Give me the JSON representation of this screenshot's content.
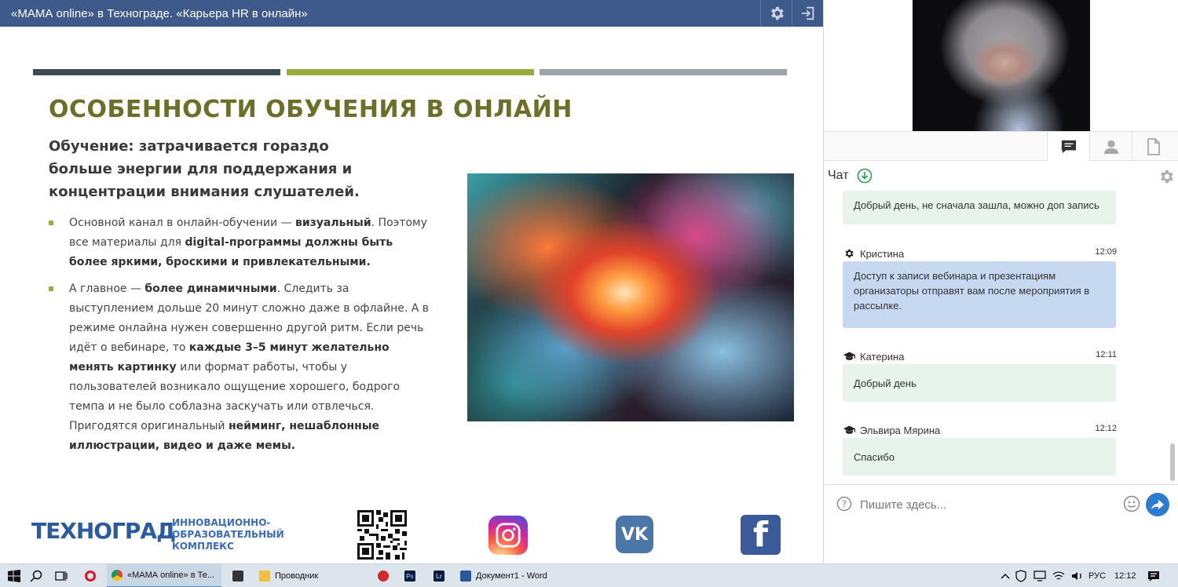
{
  "window": {
    "title": "«МАМА online» в Технограде. «Карьера HR в онлайн»"
  },
  "slide": {
    "heading": "ОСОБЕННОСТИ ОБУЧЕНИЯ В ОНЛАЙН",
    "subheading": "Обучение: затрачивается гораздо больше энергии для поддержания и концентрации внимания слушателей.",
    "bullet1": {
      "p1": "Основной канал в онлайн-обучении — ",
      "b1": "визуальный",
      "p2": ". Поэтому все материалы для ",
      "b2": "digital-программы должны быть более яркими, броскими и привлекательными."
    },
    "bullet2": {
      "p1": "А главное — ",
      "b1": "более динамичными",
      "p2": ". Следить за выступлением дольше 20 минут сложно даже в офлайне. А в режиме онлайна нужен совершенно другой ритм. Если речь идёт о вебинаре, то ",
      "b2": "каждые 3–5 минут желательно менять картинку",
      "p3": " или формат работы, чтобы у пользователей возникало ощущение хорошего, бодрого темпа и не было соблазна заскучать или отвлечься. Пригодятся оригинальный ",
      "b3": "нейминг, нешаблонные иллюстрации, видео и даже мемы."
    },
    "footer": {
      "logo": "ТЕХНОГРАД",
      "logo_sub": "ИННОВАЦИОННО-ОБРАЗОВАТЕЛЬНЫЙ КОМПЛЕКС",
      "vk": "VK",
      "fb": "f"
    }
  },
  "chat": {
    "title": "Чат",
    "messages": [
      {
        "author": "",
        "time": "",
        "text": "Добрый день, не сначала зашла, можно доп запись",
        "style": "green"
      },
      {
        "author": "Кристина",
        "time": "12:09",
        "text": "Доступ к записи вебинара и презентациям организаторы отправят вам после мероприятия в рассылке.",
        "style": "blue",
        "icon": "gear-icon"
      },
      {
        "author": "Катерина",
        "time": "12:11",
        "text": "Добрый день",
        "style": "green",
        "icon": "graduation-cap-icon"
      },
      {
        "author": "Эльвира Мярина",
        "time": "12:12",
        "text": "Спасибо",
        "style": "green",
        "icon": "graduation-cap-icon"
      }
    ],
    "input_placeholder": "Пишите здесь..."
  },
  "taskbar": {
    "chrome_label": "«МАМА online» в Те...",
    "explorer_label": "Проводник",
    "word_label": "Документ1 - Word",
    "ps_label": "Ps",
    "lr_label": "Lr",
    "lang": "РУС",
    "clock": "12:12"
  },
  "colors": {
    "titlebar": "#3e5a8a",
    "heading": "#6b6f28",
    "accent_green": "#9aab3c",
    "bubble_green": "#e6f4ec",
    "bubble_blue": "#c6d9f1",
    "send_button": "#2d7cd0"
  }
}
